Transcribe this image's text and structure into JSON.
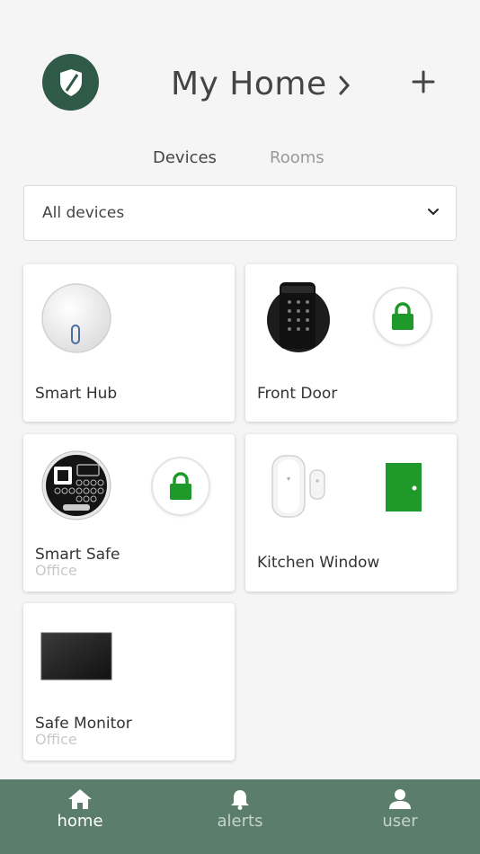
{
  "header": {
    "title": "My Home"
  },
  "tabs": [
    {
      "label": "Devices",
      "active": true
    },
    {
      "label": "Rooms",
      "active": false
    }
  ],
  "filter": {
    "value": "All devices"
  },
  "devices": [
    {
      "name": "Smart Hub",
      "room": "",
      "status_icon": "",
      "image_icon": "hub-icon"
    },
    {
      "name": "Front Door",
      "room": "",
      "status_icon": "lock-icon",
      "image_icon": "keypad-lock-icon"
    },
    {
      "name": "Smart Safe",
      "room": "Office",
      "status_icon": "lock-icon",
      "image_icon": "safe-keypad-icon"
    },
    {
      "name": "Kitchen Window",
      "room": "",
      "status_icon": "door-icon",
      "image_icon": "window-sensor-icon"
    },
    {
      "name": "Safe Monitor",
      "room": "Office",
      "status_icon": "",
      "image_icon": "monitor-icon"
    }
  ],
  "bottom_nav": [
    {
      "label": "home",
      "icon": "home-icon",
      "active": true
    },
    {
      "label": "alerts",
      "icon": "bell-icon",
      "active": false
    },
    {
      "label": "user",
      "icon": "user-icon",
      "active": false
    }
  ],
  "colors": {
    "brand_dark": "#2f5a48",
    "nav_bg": "#5a7d6c",
    "status_green": "#1f9a2a"
  }
}
